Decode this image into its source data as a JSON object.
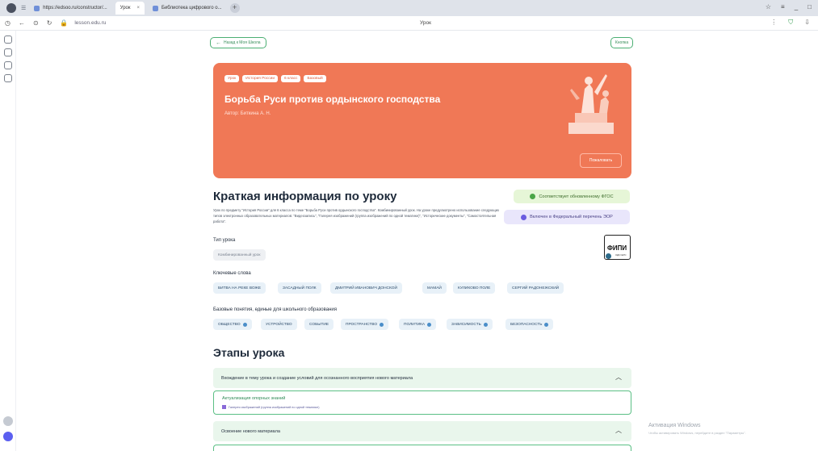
{
  "browser": {
    "tab1_label": "https://edsoo.ru/constructor/...",
    "tab2_label": "Урок",
    "tab3_label": "Библиотека цифрового о...",
    "url": "lesson.edu.ru",
    "page_title": "Урок"
  },
  "nav": {
    "back_label": "Назад к Моя Школа",
    "favorite_label": "Кнопка"
  },
  "hero": {
    "tags": [
      "Урок",
      "История России",
      "6 класс",
      "Базовый"
    ],
    "title": "Борьба Руси против ордынского господства",
    "author": "Автор: Биткина А. Н.",
    "button_label": "Пожаловать"
  },
  "summary": {
    "heading": "Краткая информация по уроку",
    "description": "Урок по предмету \"История России\" для 6 класса по теме \"Борьба Руси против ордынского господства\". Комбинированный урок. На уроке предусмотрено использование следующих типов электронных образовательных материалов: \"Видеозапись\", \"Галерея изображений (группа изображений по одной тематике)\", \"Исторические документы\", \"Самостоятельная работа\".",
    "badge_fgos": "Соответствует обновленному ФГОС",
    "badge_eor": "Включен в Федеральный перечень ЭОР",
    "fipi_logo": "ФИПИ",
    "fipi_sub": "ОДО ЕРС"
  },
  "lesson_type": {
    "label": "Тип урока",
    "value": "Комбинированный урок"
  },
  "keywords": {
    "label": "Ключевые слова",
    "items": [
      "БИТВА НА РЕКЕ ВОЖЕ",
      "ЗАСАДНЫЙ ПОЛК",
      "ДМИТРИЙ ИВАНОВИЧ ДОНСКОЙ",
      "МАМАЙ",
      "КУЛИКОВО ПОЛЕ",
      "СЕРГИЙ РАДОНЕЖСКИЙ"
    ]
  },
  "concepts": {
    "label": "Базовые понятия, единые для школьного образования",
    "items": [
      "ОБЩЕСТВО",
      "УСТРОЙСТВО",
      "СОБЫТИЕ",
      "ПРОСТРАНСТВО",
      "ПОЛИТИКА",
      "ЗАВИСИМОСТЬ",
      "БЕЗОПАСНОСТЬ"
    ]
  },
  "stages": {
    "heading": "Этапы урока",
    "stage1": "Вхождение в тему урока и создание условий для осознанного восприятия нового материала",
    "sub1_title": "Актуализация опорных знаний",
    "sub1_note": "Галерея изображений (группа изображений по одной тематике)",
    "stage2": "Освоение нового материала"
  },
  "watermark": {
    "line1": "Активация Windows",
    "line2": "Чтобы активировать Windows, перейдите в раздел \"Параметры\"."
  }
}
